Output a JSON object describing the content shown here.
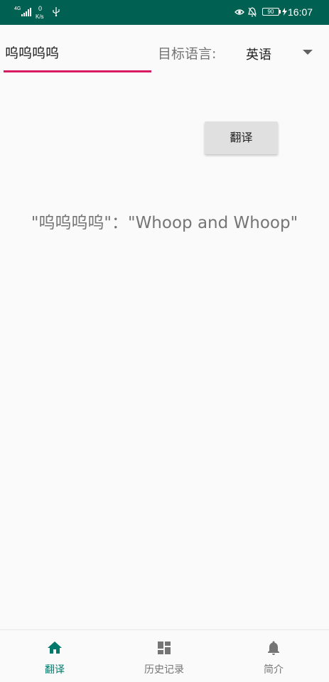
{
  "status_bar": {
    "network_type": "4G",
    "speed_value": "0",
    "speed_unit": "K/s",
    "battery_level": "90",
    "time": "16:07",
    "icons": [
      "signal-icon",
      "usb-icon",
      "eye-icon",
      "mute-bell-icon",
      "battery-icon",
      "charging-bolt-icon"
    ]
  },
  "translator": {
    "source_text": "呜呜呜呜",
    "target_language_label": "目标语言:",
    "target_language_value": "英语",
    "translate_button_label": "翻译",
    "result": "\"呜呜呜呜\"：\"Whoop and Whoop\""
  },
  "bottom_nav": {
    "items": [
      {
        "label": "翻译",
        "icon": "home-icon",
        "active": true
      },
      {
        "label": "历史记录",
        "icon": "dashboard-icon",
        "active": false
      },
      {
        "label": "简介",
        "icon": "bell-icon",
        "active": false
      }
    ]
  },
  "colors": {
    "status_bar": "#006152",
    "accent": "#d81b60",
    "nav_active": "#00796b",
    "nav_inactive": "#757575"
  }
}
